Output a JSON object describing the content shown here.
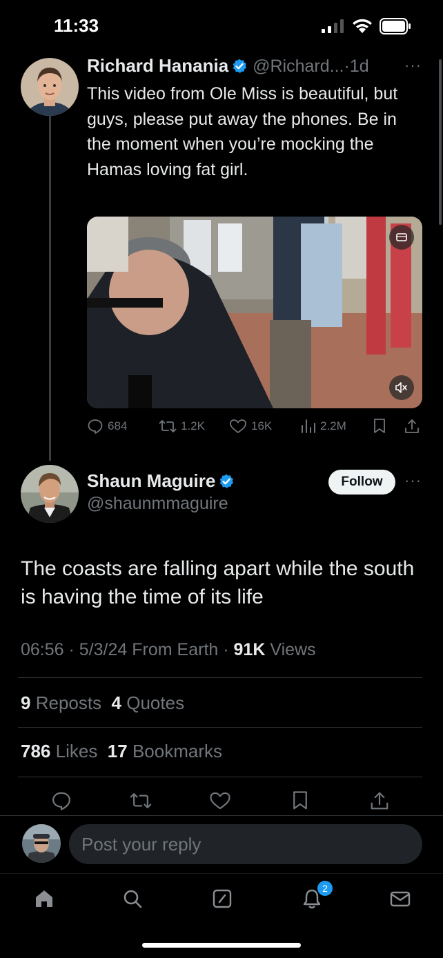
{
  "status_bar": {
    "time": "11:33"
  },
  "quoted_tweet": {
    "author_name": "Richard Hanania",
    "handle": "@Richard...",
    "separator": "·",
    "age": "1d",
    "text": "This video from Ole Miss is beautiful, but guys, please put away the phones. Be in the moment when you’re mocking the Hamas loving fat girl.",
    "actions": {
      "replies": "684",
      "reposts": "1.2K",
      "likes": "16K",
      "views": "2.2M"
    }
  },
  "main_tweet": {
    "author_name": "Shaun Maguire",
    "handle": "@shaunmmaguire",
    "follow_label": "Follow",
    "text": "The coasts are falling apart while the south is having the time of its life",
    "time": "06:56",
    "date": "5/3/24",
    "source": "From Earth",
    "separator": "·",
    "views_count": "91K",
    "views_label": "Views",
    "reposts_count": "9",
    "reposts_label": "Reposts",
    "quotes_count": "4",
    "quotes_label": "Quotes",
    "likes_count": "786",
    "likes_label": "Likes",
    "bookmarks_count": "17",
    "bookmarks_label": "Bookmarks"
  },
  "reply": {
    "placeholder": "Post your reply"
  },
  "tab_bar": {
    "notifications_badge": "2"
  },
  "colors": {
    "accent": "#1d9bf0",
    "background": "#000000",
    "text": "#e7e9ea",
    "muted": "#71767b"
  }
}
